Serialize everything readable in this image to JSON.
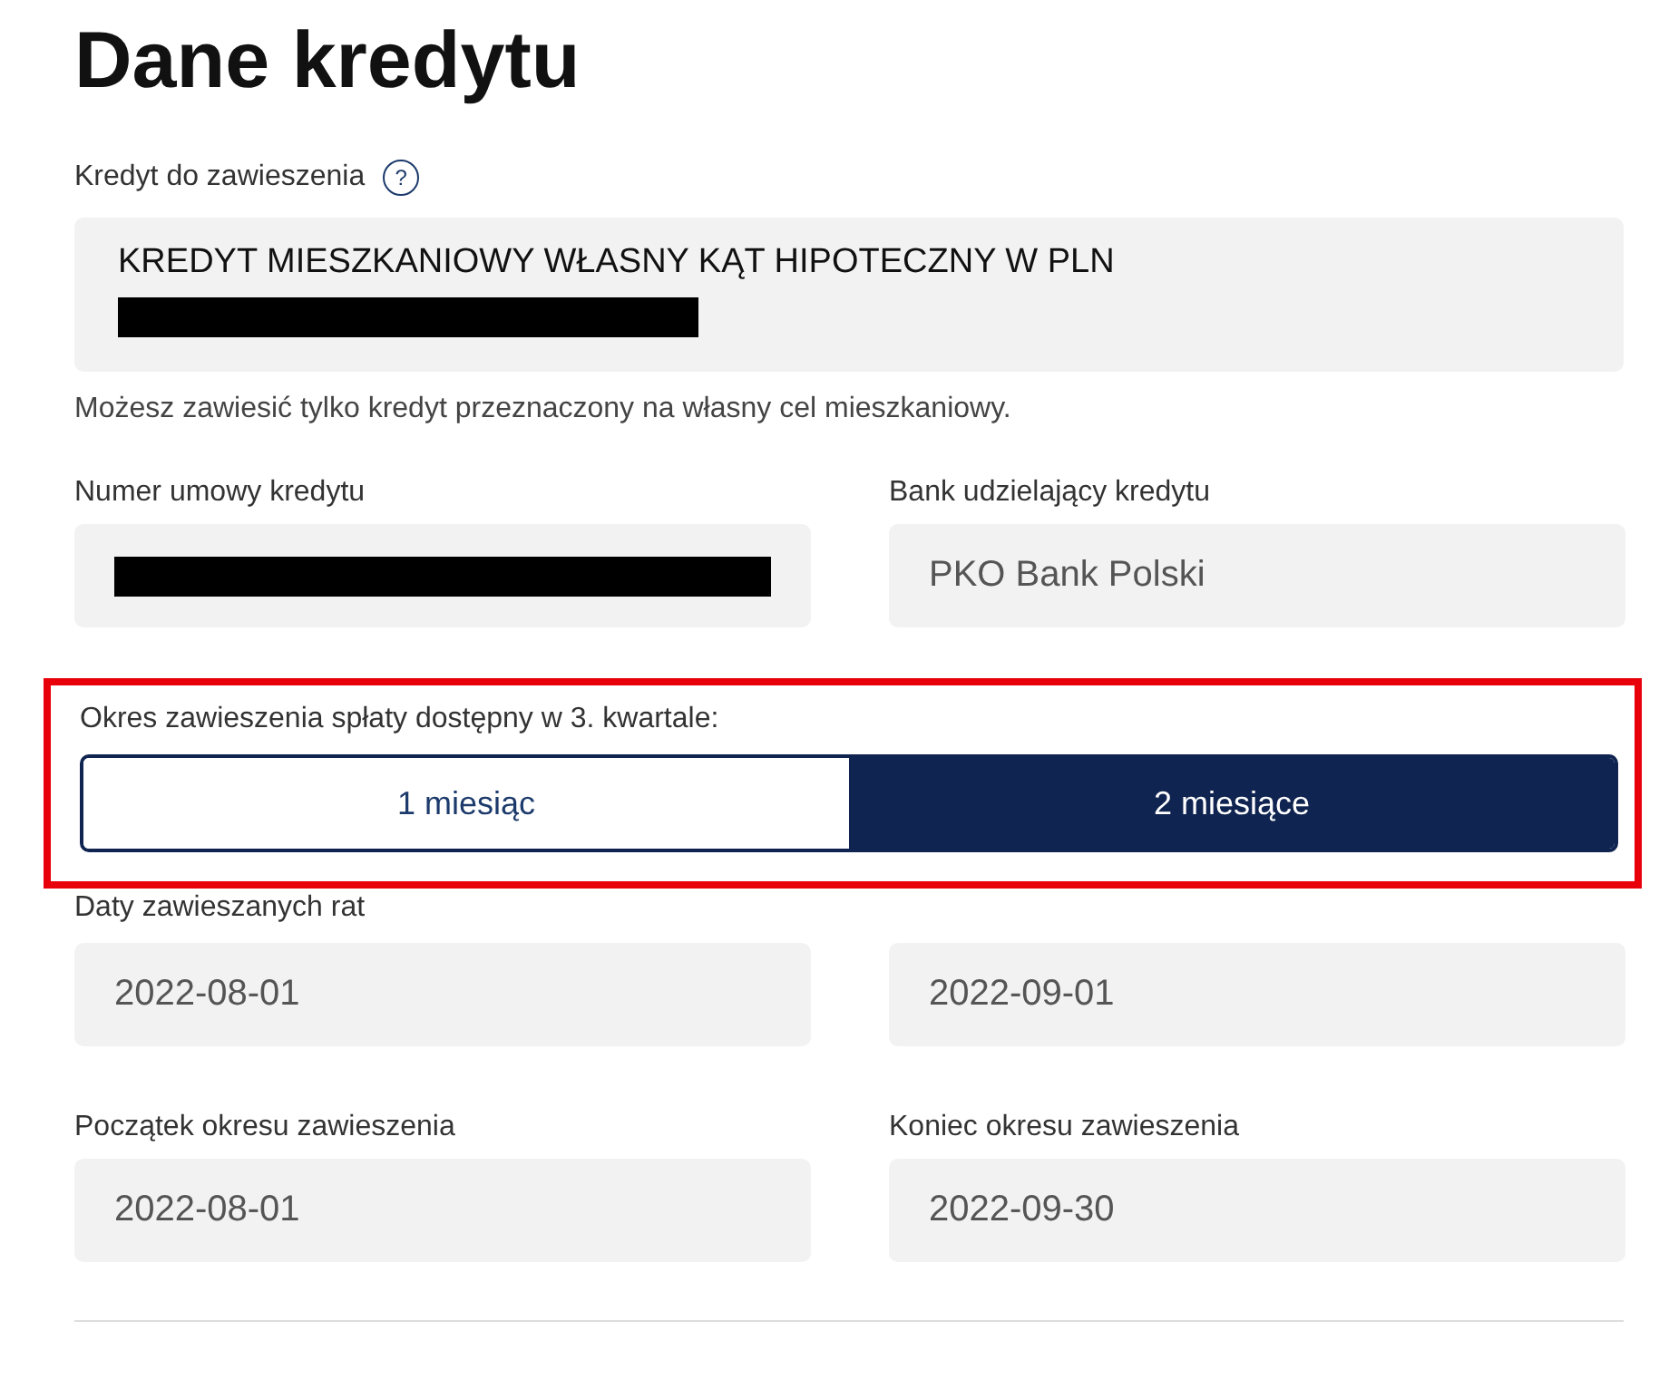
{
  "title": "Dane kredytu",
  "loan": {
    "label": "Kredyt do zawieszenia",
    "help": "?",
    "value": "KREDYT MIESZKANIOWY WŁASNY KĄT HIPOTECZNY W PLN",
    "redacted": true,
    "note": "Możesz zawiesić tylko kredyt przeznaczony na własny cel mieszkaniowy."
  },
  "contract_fields": [
    {
      "label": "Numer umowy kredytu",
      "redacted": true
    },
    {
      "label": "Bank udzielający kredytu",
      "value": "PKO Bank Polski",
      "redacted": false
    }
  ],
  "period": {
    "label": "Okres zawieszenia spłaty dostępny w 3. kwartale:",
    "highlighted": true,
    "options": [
      {
        "label": "1 miesiąc",
        "selected": false
      },
      {
        "label": "2 miesiące",
        "selected": true
      }
    ]
  },
  "installments": {
    "label": "Daty zawieszanych rat",
    "values": [
      "2022-08-01",
      "2022-09-01"
    ]
  },
  "range_fields": [
    {
      "label": "Początek okresu zawieszenia",
      "value": "2022-08-01"
    },
    {
      "label": "Koniec okresu zawieszenia",
      "value": "2022-09-30"
    }
  ]
}
